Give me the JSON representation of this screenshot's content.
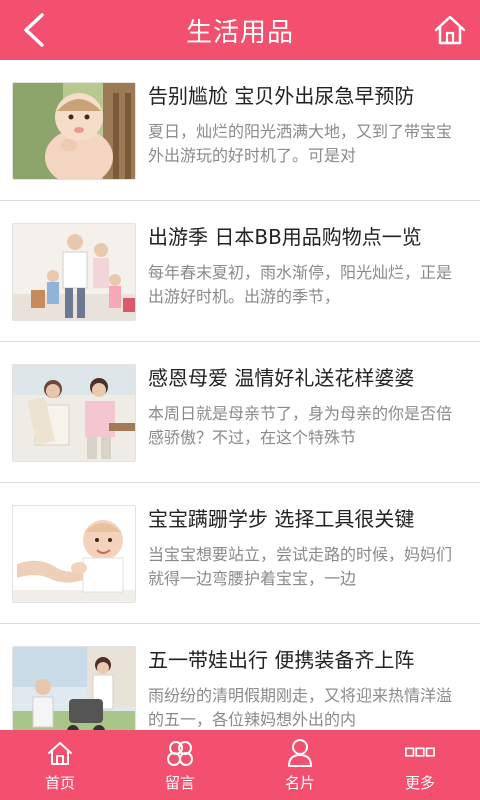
{
  "header": {
    "title": "生活用品",
    "back_icon": "back-chevron-icon",
    "home_icon": "home-icon"
  },
  "articles": [
    {
      "title": "告别尴尬 宝贝外出尿急早预防",
      "desc": "夏日，灿烂的阳光洒满大地，又到了带宝宝外出游玩的好时机了。可是对"
    },
    {
      "title": "出游季 日本BB用品购物点一览",
      "desc": "每年春末夏初，雨水渐停，阳光灿烂，正是出游好时机。出游的季节，"
    },
    {
      "title": "感恩母爱 温情好礼送花样婆婆",
      "desc": "本周日就是母亲节了，身为母亲的你是否倍感骄傲？不过，在这个特殊节"
    },
    {
      "title": "宝宝蹒跚学步 选择工具很关键",
      "desc": "当宝宝想要站立，尝试走路的时候，妈妈们就得一边弯腰护着宝宝，一边"
    },
    {
      "title": "五一带娃出行 便携装备齐上阵",
      "desc": "雨纷纷的清明假期刚走，又将迎来热情洋溢的五一，各位辣妈想外出的内"
    }
  ],
  "tabs": [
    {
      "label": "首页",
      "icon": "home-icon"
    },
    {
      "label": "留言",
      "icon": "message-icon"
    },
    {
      "label": "名片",
      "icon": "person-icon"
    },
    {
      "label": "更多",
      "icon": "more-icon"
    }
  ],
  "colors": {
    "accent": "#f2506e",
    "title_text": "#222222",
    "desc_text": "#8a8a8a"
  }
}
